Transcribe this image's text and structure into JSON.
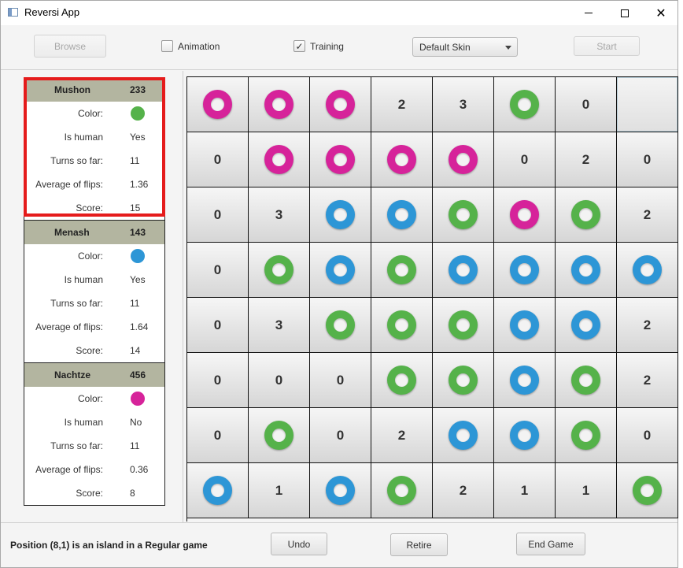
{
  "window": {
    "title": "Reversi App",
    "icon": "window-app-icon"
  },
  "toolbar": {
    "browse_label": "Browse",
    "animation_label": "Animation",
    "animation_checked": false,
    "training_label": "Training",
    "training_checked": true,
    "training_check_glyph": "✓",
    "skin_selected": "Default Skin",
    "start_label": "Start"
  },
  "colors": {
    "pink": "#d6239a",
    "green": "#55b24a",
    "blue": "#2d96d6",
    "highlight": "#e51b1b",
    "header": "#b3b5a0"
  },
  "players": [
    {
      "name": "Mushon",
      "points": "233",
      "color_label": "Color:",
      "color": "green",
      "human_label": "Is human",
      "human": "Yes",
      "turns_label": "Turns so far:",
      "turns": "11",
      "flips_label": "Average of flips:",
      "flips": "1.36",
      "score_label": "Score:",
      "score": "15"
    },
    {
      "name": "Menash",
      "points": "143",
      "color_label": "Color:",
      "color": "blue",
      "human_label": "Is human",
      "human": "Yes",
      "turns_label": "Turns so far:",
      "turns": "11",
      "flips_label": "Average of flips:",
      "flips": "1.64",
      "score_label": "Score:",
      "score": "14"
    },
    {
      "name": "Nachtze",
      "points": "456",
      "color_label": "Color:",
      "color": "pink",
      "human_label": "Is human",
      "human": "No",
      "turns_label": "Turns so far:",
      "turns": "11",
      "flips_label": "Average of flips:",
      "flips": "0.36",
      "score_label": "Score:",
      "score": "8"
    }
  ],
  "board": [
    [
      "pink",
      "pink",
      "pink",
      "2",
      "3",
      "green",
      "0",
      ""
    ],
    [
      "0",
      "pink",
      "pink",
      "pink",
      "pink",
      "0",
      "2",
      "0"
    ],
    [
      "0",
      "3",
      "blue",
      "blue",
      "green",
      "pink",
      "green",
      "2"
    ],
    [
      "0",
      "green",
      "blue",
      "green",
      "blue",
      "blue",
      "blue",
      "blue"
    ],
    [
      "0",
      "3",
      "green",
      "green",
      "green",
      "blue",
      "blue",
      "2"
    ],
    [
      "0",
      "0",
      "0",
      "green",
      "green",
      "blue",
      "green",
      "2"
    ],
    [
      "0",
      "green",
      "0",
      "2",
      "blue",
      "blue",
      "green",
      "0"
    ],
    [
      "blue",
      "1",
      "blue",
      "green",
      "2",
      "1",
      "1",
      "green"
    ]
  ],
  "status": {
    "message": "Position (8,1) is an island in a Regular game",
    "undo_label": "Undo",
    "retire_label": "Retire",
    "end_game_label": "End Game"
  }
}
